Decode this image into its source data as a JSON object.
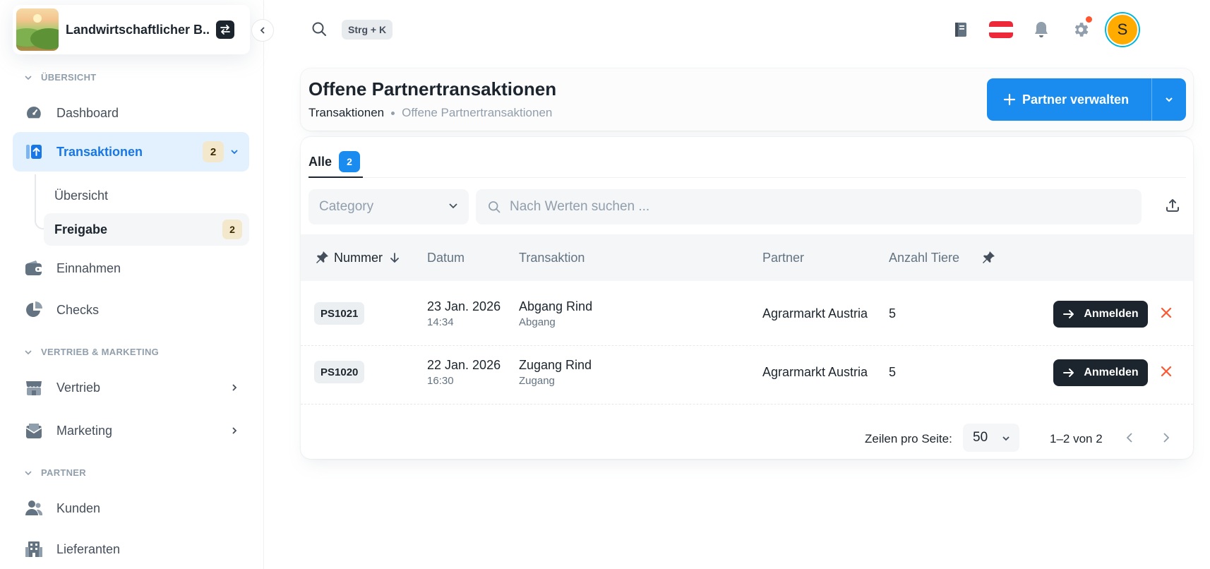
{
  "org": {
    "name": "Landwirtschaftlicher B..."
  },
  "sidebar": {
    "sections": {
      "overview": "ÜBERSICHT",
      "sales_marketing": "VERTRIEB & MARKETING",
      "partner": "PARTNER"
    },
    "items": {
      "dashboard": "Dashboard",
      "transactions": "Transaktionen",
      "transactions_badge": "2",
      "sub_overview": "Übersicht",
      "sub_release": "Freigabe",
      "sub_release_badge": "2",
      "income": "Einnahmen",
      "checks": "Checks",
      "sales": "Vertrieb",
      "marketing": "Marketing",
      "customers": "Kunden",
      "suppliers": "Lieferanten"
    }
  },
  "topbar": {
    "shortcut": "Strg + K",
    "avatar_letter": "S"
  },
  "header": {
    "title": "Offene Partnertransaktionen",
    "breadcrumb": [
      "Transaktionen",
      "Offene Partnertransaktionen"
    ],
    "primary_button": "Partner verwalten"
  },
  "tabs": [
    {
      "label": "Alle",
      "count": "2"
    }
  ],
  "filters": {
    "category_placeholder": "Category",
    "search_placeholder": "Nach Werten suchen ..."
  },
  "table": {
    "columns": [
      "Nummer",
      "Datum",
      "Transaktion",
      "Partner",
      "Anzahl Tiere"
    ],
    "action_label": "Anmelden",
    "rows": [
      {
        "number": "PS1021",
        "date": "23 Jan. 2026",
        "time": "14:34",
        "transaction": "Abgang Rind",
        "type": "Abgang",
        "partner": "Agrarmarkt Austria",
        "animals": "5"
      },
      {
        "number": "PS1020",
        "date": "22 Jan. 2026",
        "time": "16:30",
        "transaction": "Zugang Rind",
        "type": "Zugang",
        "partner": "Agrarmarkt Austria",
        "animals": "5"
      }
    ]
  },
  "pagination": {
    "rows_per_page_label": "Zeilen pro Seite:",
    "rows_per_page": "50",
    "range": "1–2 von 2"
  },
  "colors": {
    "primary": "#1a8cf0",
    "danger": "#ff5630",
    "badge": "#f3e7cc",
    "active_bg": "#e3f1ff"
  }
}
